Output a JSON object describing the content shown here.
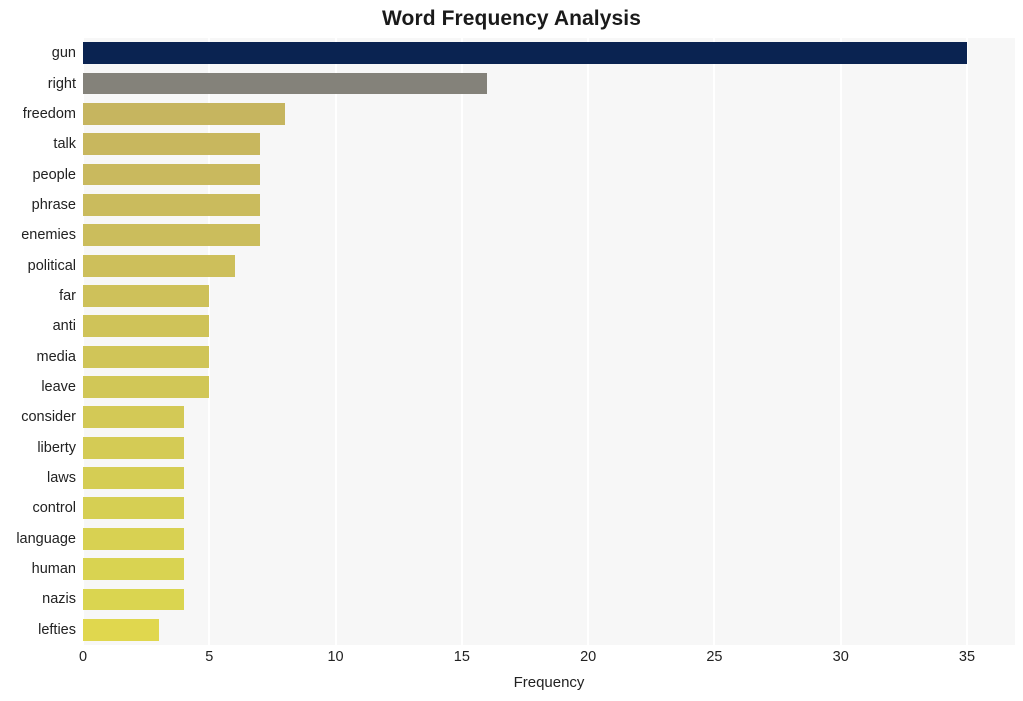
{
  "chart_data": {
    "type": "bar",
    "orientation": "horizontal",
    "title": "Word Frequency Analysis",
    "xlabel": "Frequency",
    "ylabel": "",
    "categories": [
      "gun",
      "right",
      "freedom",
      "talk",
      "people",
      "phrase",
      "enemies",
      "political",
      "far",
      "anti",
      "media",
      "leave",
      "consider",
      "liberty",
      "laws",
      "control",
      "language",
      "human",
      "nazis",
      "lefties"
    ],
    "values": [
      35,
      16,
      8,
      7,
      7,
      7,
      7,
      6,
      5,
      5,
      5,
      5,
      4,
      4,
      4,
      4,
      4,
      4,
      4,
      3
    ],
    "bar_colors": [
      "#0a2351",
      "#84827a",
      "#c6b55f",
      "#c8b75e",
      "#c9b95e",
      "#cabb5d",
      "#cbbd5c",
      "#cdbf5b",
      "#cec15a",
      "#cfc359",
      "#d0c558",
      "#d1c757",
      "#d3c956",
      "#d4cb55",
      "#d5cd54",
      "#d6cf53",
      "#d8d152",
      "#d9d351",
      "#dad550",
      "#e0d74e"
    ],
    "xlim": [
      0,
      36.9
    ],
    "xticks": [
      0,
      5,
      10,
      15,
      20,
      25,
      30,
      35
    ],
    "xticklabels": [
      "0",
      "5",
      "10",
      "15",
      "20",
      "25",
      "30",
      "35"
    ],
    "grid": "vertical-white",
    "legend": "none",
    "plot_background": "#f7f7f7",
    "figure_background": "#ffffff",
    "tick_label_color": "#222222"
  }
}
